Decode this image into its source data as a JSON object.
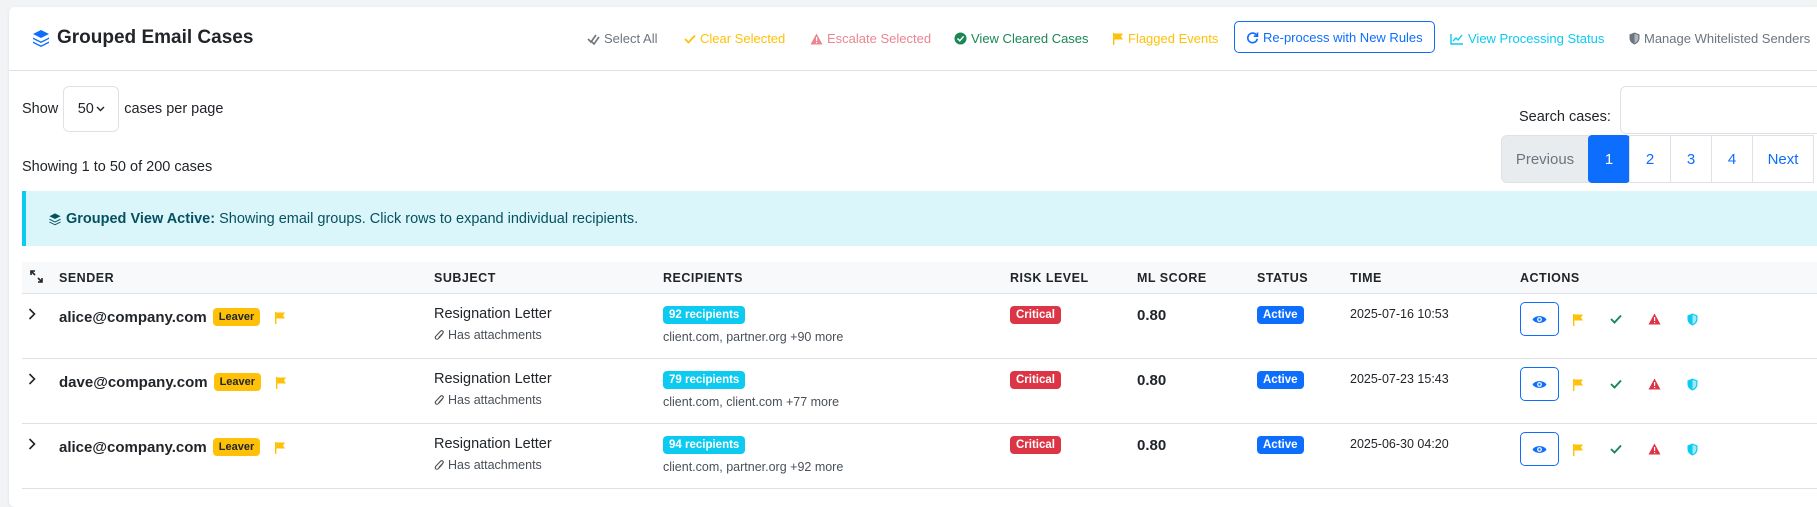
{
  "header": {
    "title": "Grouped Email Cases",
    "buttons": {
      "select_all": "Select All",
      "clear_selected": "Clear Selected",
      "escalate_selected": "Escalate Selected",
      "view_cleared": "View Cleared Cases",
      "flagged_events": "Flagged Events",
      "reprocess": "Re-process with New Rules",
      "processing_status": "View Processing Status",
      "whitelist": "Manage Whitelisted Senders"
    }
  },
  "controls": {
    "show_label": "Show",
    "per_page_value": "50",
    "per_page_suffix": "cases per page",
    "search_label": "Search cases:",
    "search_value": "",
    "showing_text": "Showing 1 to 50 of 200 cases"
  },
  "pagination": {
    "previous": "Previous",
    "pages": [
      "1",
      "2",
      "3",
      "4"
    ],
    "next": "Next",
    "current": "1"
  },
  "alert": {
    "strong": "Grouped View Active:",
    "text": "Showing email groups. Click rows to expand individual recipients."
  },
  "table": {
    "columns": {
      "sender": "SENDER",
      "subject": "SUBJECT",
      "recipients": "RECIPIENTS",
      "risk": "RISK LEVEL",
      "score": "ML SCORE",
      "status": "STATUS",
      "time": "TIME",
      "actions": "ACTIONS"
    },
    "rows": [
      {
        "sender": "alice@company.com",
        "tag": "Leaver",
        "subject": "Resignation Letter",
        "attachments": "Has attachments",
        "recipients_badge": "92 recipients",
        "domains": "client.com, partner.org +90 more",
        "risk": "Critical",
        "score": "0.80",
        "status": "Active",
        "time": "2025-07-16 10:53"
      },
      {
        "sender": "dave@company.com",
        "tag": "Leaver",
        "subject": "Resignation Letter",
        "attachments": "Has attachments",
        "recipients_badge": "79 recipients",
        "domains": "client.com, client.com +77 more",
        "risk": "Critical",
        "score": "0.80",
        "status": "Active",
        "time": "2025-07-23 15:43"
      },
      {
        "sender": "alice@company.com",
        "tag": "Leaver",
        "subject": "Resignation Letter",
        "attachments": "Has attachments",
        "recipients_badge": "94 recipients",
        "domains": "client.com, partner.org +92 more",
        "risk": "Critical",
        "score": "0.80",
        "status": "Active",
        "time": "2025-06-30 04:20"
      }
    ]
  },
  "colors": {
    "primary": "#0d6efd",
    "warning": "#ffc107",
    "danger": "#dc3545",
    "success": "#198754",
    "info": "#0dcaf0"
  }
}
